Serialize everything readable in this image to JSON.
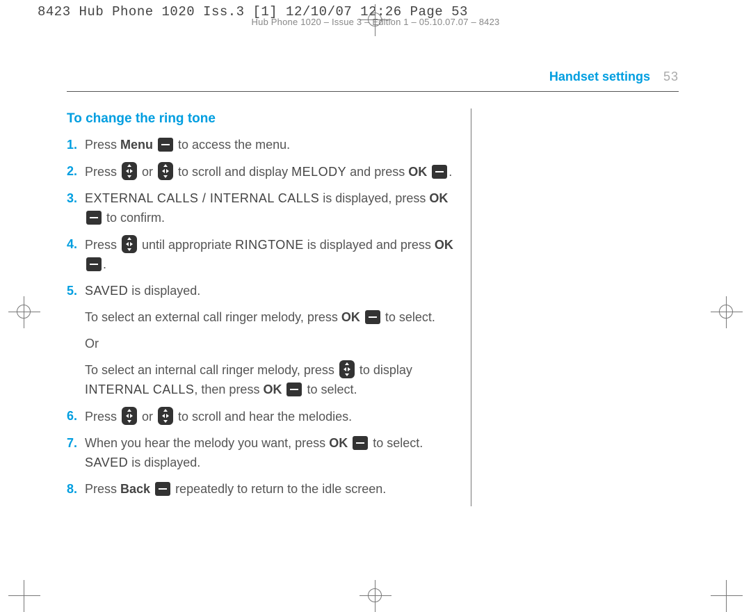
{
  "print_header": "8423 Hub Phone 1020 Iss.3 [1]  12/10/07  12:26  Page 53",
  "print_subheader": "Hub Phone 1020 – Issue 3 – Edition 1 – 05.10.07.07 – 8423",
  "running_head": {
    "title": "Handset settings",
    "page_num": "53"
  },
  "section_title": "To change the ring tone",
  "steps": {
    "s1": {
      "num": "1.",
      "a": "Press ",
      "menu": "Menu",
      "b": " to access the menu."
    },
    "s2": {
      "num": "2.",
      "a": "Press ",
      "mid": " or ",
      "b": " to scroll and display ",
      "lcd": "MELODY",
      "c": " and press ",
      "ok": "OK",
      "d": "."
    },
    "s3": {
      "num": "3.",
      "lcd": "EXTERNAL CALLS / INTERNAL CALLS",
      "a": " is displayed, press ",
      "ok": "OK",
      "b": " to confirm."
    },
    "s4": {
      "num": "4.",
      "a": "Press ",
      "b": " until appropriate ",
      "lcd": "RINGTONE",
      "c": " is displayed and press ",
      "ok": "OK",
      "d": "."
    },
    "s5": {
      "num": "5.",
      "lcd": "SAVED",
      "a": " is displayed."
    },
    "p1": {
      "a": "To select an external call ringer melody, press ",
      "ok": "OK",
      "b": " to select."
    },
    "p_or": "Or",
    "p2": {
      "a": "To select an internal call ringer melody, press ",
      "b": " to display ",
      "lcd": "INTERNAL CALLS",
      "c": ", then press ",
      "ok": "OK",
      "d": " to select."
    },
    "s6": {
      "num": "6.",
      "a": "Press ",
      "mid": " or ",
      "b": " to scroll and hear the melodies."
    },
    "s7": {
      "num": "7.",
      "a": "When you hear the melody you want, press ",
      "ok": "OK",
      "b": " to select. ",
      "lcd": "SAVED",
      "c": " is displayed."
    },
    "s8": {
      "num": "8.",
      "a": "Press ",
      "back": "Back",
      "b": " repeatedly to return to the idle screen."
    }
  }
}
